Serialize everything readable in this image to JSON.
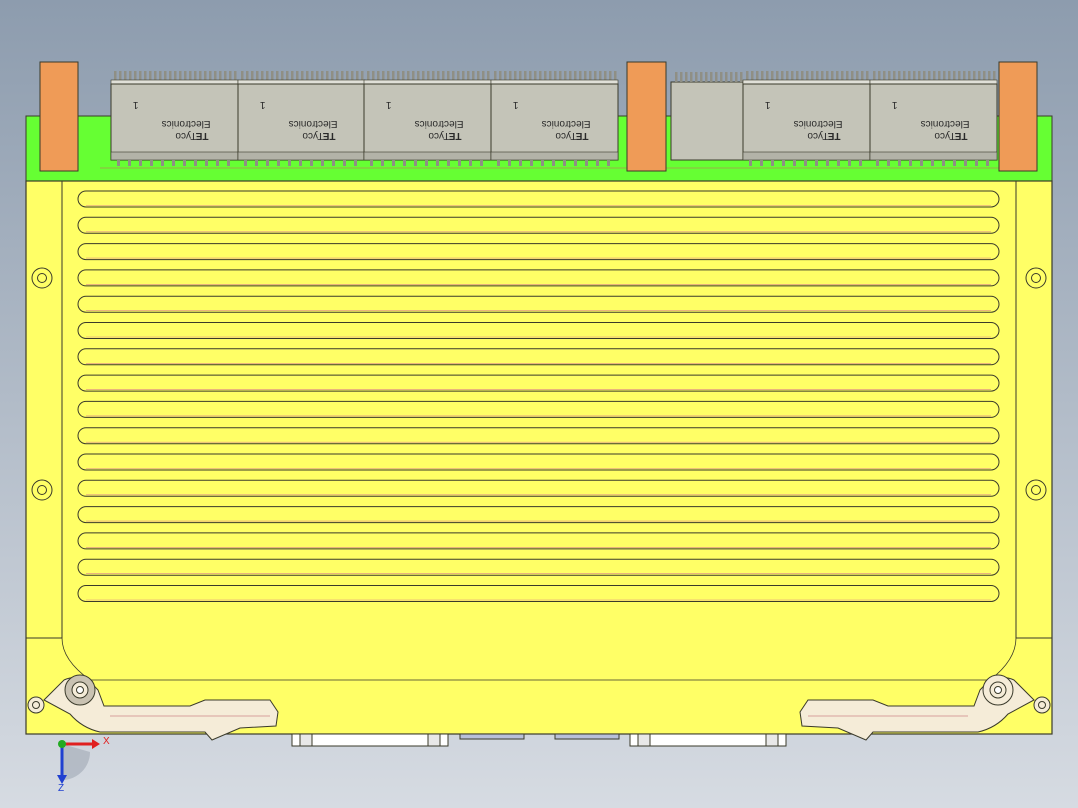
{
  "colors": {
    "bg_top": "#8d9cae",
    "bg_bottom": "#d6dbe2",
    "board": "#ffff66",
    "pcb": "#66ff33",
    "connector": "#c4c4b8",
    "connector_dark": "#8f8f85",
    "guide": "#ef9b57",
    "handle": "#f5ecd8",
    "outline": "#3a3a2a",
    "axis_x": "#e02020",
    "axis_y": "#22aa22",
    "axis_z": "#2040d0"
  },
  "connectors": [
    {
      "brand": "Tyco",
      "name": "Electronics",
      "pin": "1"
    },
    {
      "brand": "Tyco",
      "name": "Electronics",
      "pin": "1"
    },
    {
      "brand": "Tyco",
      "name": "Electronics",
      "pin": "1"
    },
    {
      "brand": "Tyco",
      "name": "Electronics",
      "pin": "1"
    },
    {
      "brand": "Tyco",
      "name": "Electronics",
      "pin": "1"
    },
    {
      "brand": "Tyco",
      "name": "Electronics",
      "pin": "1"
    }
  ],
  "axes": {
    "x": "X",
    "z": "Z"
  },
  "cooling_slots": 16
}
